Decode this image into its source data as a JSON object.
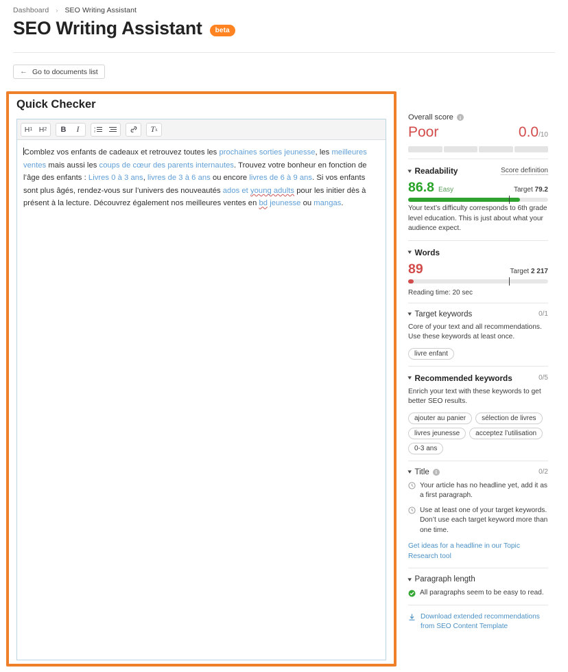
{
  "breadcrumb": {
    "root": "Dashboard",
    "separator": "›",
    "current": "SEO Writing Assistant"
  },
  "header": {
    "title": "SEO Writing Assistant",
    "badge": "beta"
  },
  "toolbar": {
    "back_button": "Go to documents list",
    "back_arrow": "←"
  },
  "checker": {
    "title": "Quick Checker",
    "editor_toolbar": [
      {
        "name": "h1",
        "label": "H",
        "sub": "1"
      },
      {
        "name": "h2",
        "label": "H",
        "sub": "2"
      },
      {
        "name": "bold",
        "label": "B"
      },
      {
        "name": "italic",
        "label": "I"
      },
      {
        "name": "ordered-list",
        "label": ""
      },
      {
        "name": "unordered-list",
        "label": ""
      },
      {
        "name": "link",
        "label": ""
      },
      {
        "name": "clear-formatting",
        "label": "T",
        "sub": "x"
      }
    ],
    "text_runs": [
      {
        "t": "Comblez vos enfants de cadeaux et retrouvez toutes les ",
        "k": "plain"
      },
      {
        "t": "prochaines sorties jeunesse",
        "k": "link"
      },
      {
        "t": ", les ",
        "k": "plain"
      },
      {
        "t": "meilleures ventes",
        "k": "link"
      },
      {
        "t": " mais aussi les ",
        "k": "plain"
      },
      {
        "t": "coups de cœur des parents internautes",
        "k": "link"
      },
      {
        "t": ". Trouvez votre bonheur en fonction de l’âge des enfants : ",
        "k": "plain"
      },
      {
        "t": "Livres 0 à 3 ans",
        "k": "link"
      },
      {
        "t": ", ",
        "k": "plain"
      },
      {
        "t": "livres de 3 à 6 ans",
        "k": "link"
      },
      {
        "t": " ou encore ",
        "k": "plain"
      },
      {
        "t": "livres de 6 à 9 ans",
        "k": "link"
      },
      {
        "t": ". Si vos enfants sont plus âgés, rendez-vous sur l’univers des nouveautés ",
        "k": "plain"
      },
      {
        "t": "ados et ",
        "k": "link"
      },
      {
        "t": "young adults",
        "k": "spell"
      },
      {
        "t": " pour les initier dès à présent à la lecture. Découvrez également nos meilleures ventes en ",
        "k": "plain"
      },
      {
        "t": "bd",
        "k": "spell"
      },
      {
        "t": " jeunesse",
        "k": "link"
      },
      {
        "t": " ou ",
        "k": "plain"
      },
      {
        "t": "mangas",
        "k": "link"
      },
      {
        "t": ".",
        "k": "plain"
      }
    ]
  },
  "panel": {
    "overall": {
      "label": "Overall score",
      "verdict": "Poor",
      "score": "0.0",
      "denominator": "/10",
      "segments": 4,
      "filled_segments": 0,
      "color": "#d34c4c"
    },
    "readability": {
      "title": "Readability",
      "score_definition": "Score definition",
      "value": "86.8",
      "tag": "Easy",
      "target_label": "Target",
      "target_value": "79.2",
      "fill_percent": 80,
      "tick_percent": 72,
      "color": "#2fa22f",
      "description": "Your text’s difficulty corresponds to 6th grade level education. This is just about what your audience expect."
    },
    "words": {
      "title": "Words",
      "value": "89",
      "target_label": "Target",
      "target_value": "2 217",
      "fill_percent": 4,
      "tick_percent": 72,
      "color": "#d34c4c",
      "reading_time": "Reading time: 20 sec"
    },
    "target_keywords": {
      "title": "Target keywords",
      "count": "0/1",
      "description": "Core of your text and all recommendations. Use these keywords at least once.",
      "chips": [
        "livre enfant"
      ]
    },
    "recommended_keywords": {
      "title": "Recommended keywords",
      "count": "0/5",
      "description": "Enrich your text with these keywords to get better SEO results.",
      "chips": [
        "ajouter au panier",
        "sélection de livres",
        "livres jeunesse",
        "acceptez l’utilisation",
        "0-3 ans"
      ]
    },
    "title_section": {
      "title": "Title",
      "count": "0/2",
      "items": [
        {
          "status": "warning",
          "text": "Your article has no headline yet, add it as a first paragraph."
        },
        {
          "status": "warning",
          "text": "Use at least one of your target keywords. Don’t use each target keyword more than one time."
        }
      ],
      "link": "Get ideas for a headline in our Topic Research tool"
    },
    "paragraph_length": {
      "title": "Paragraph length",
      "items": [
        {
          "status": "ok",
          "text": "All paragraphs seem to be easy to read."
        }
      ]
    },
    "download": {
      "label": "Download extended recommendations from SEO Content Template"
    }
  }
}
